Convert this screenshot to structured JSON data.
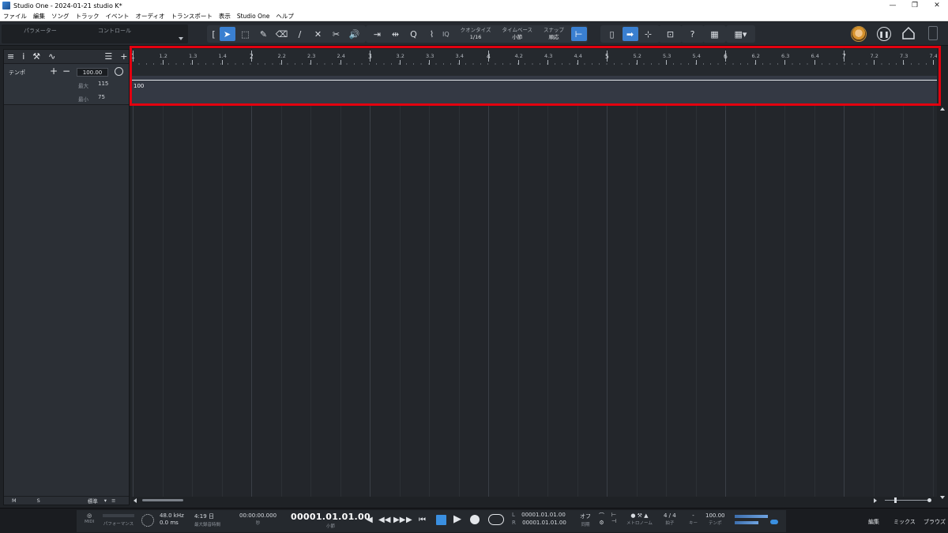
{
  "window": {
    "title": "Studio One - 2024-01-21 studio K*",
    "controls": [
      "—",
      "❐",
      "✕"
    ]
  },
  "menu": [
    "ファイル",
    "編集",
    "ソング",
    "トラック",
    "イベント",
    "オーディオ",
    "トランスポート",
    "表示",
    "Studio One",
    "ヘルプ"
  ],
  "toolbar": {
    "parameter_label": "パラメーター",
    "control_label": "コントロール",
    "quantize": {
      "label": "クオンタイズ",
      "value": "1/16"
    },
    "timebase": {
      "label": "タイムベース",
      "value": "小節"
    },
    "snap": {
      "label": "スナップ",
      "value": "順応"
    },
    "iq_label": "IQ",
    "help_label": "?"
  },
  "inspector": {
    "tempo_track_name": "テンポ",
    "plus": "+",
    "minus": "−",
    "tempo_value": "100.00",
    "max_label": "最大",
    "max_value": "115",
    "min_label": "最小",
    "min_value": "75",
    "bottom": {
      "m": "M",
      "s": "S",
      "mode": "標準"
    }
  },
  "ruler": {
    "labels": [
      "1",
      "1.2",
      "1.3",
      "1.4",
      "2",
      "2.2",
      "2.3",
      "2.4",
      "3",
      "3.2",
      "3.3",
      "3.4",
      "4",
      "4.2",
      "4.3",
      "4.4",
      "5",
      "5.2",
      "5.3",
      "5.4",
      "6",
      "6.2",
      "6.3",
      "6.4",
      "7",
      "7.2",
      "7.3",
      "7.4"
    ]
  },
  "tempo_lane": {
    "value_label": "100"
  },
  "transport": {
    "midi_label": "MIDI",
    "performance_label": "パフォーマンス",
    "sample_rate": "48.0 kHz",
    "latency": "0.0 ms",
    "record_time": "4:19 日",
    "record_time_label": "最大録音時間",
    "time_seconds": "00:00:00.000",
    "time_seconds_unit": "秒",
    "position": "00001.01.01.00",
    "position_unit": "小節",
    "loop_left": "00001.01.01.00",
    "loop_right": "00001.01.01.00",
    "l_label": "L",
    "r_label": "R",
    "sync_value": "オフ",
    "sync_label": "同期",
    "metronome_label": "メトロノーム",
    "time_sig": "4 / 4",
    "time_sig_label": "拍子",
    "key_value": "-",
    "key_label": "キー",
    "tempo_value": "100.00",
    "tempo_label": "テンポ",
    "edit_label": "編集",
    "mix_label": "ミックス",
    "browse_label": "ブラウズ"
  }
}
